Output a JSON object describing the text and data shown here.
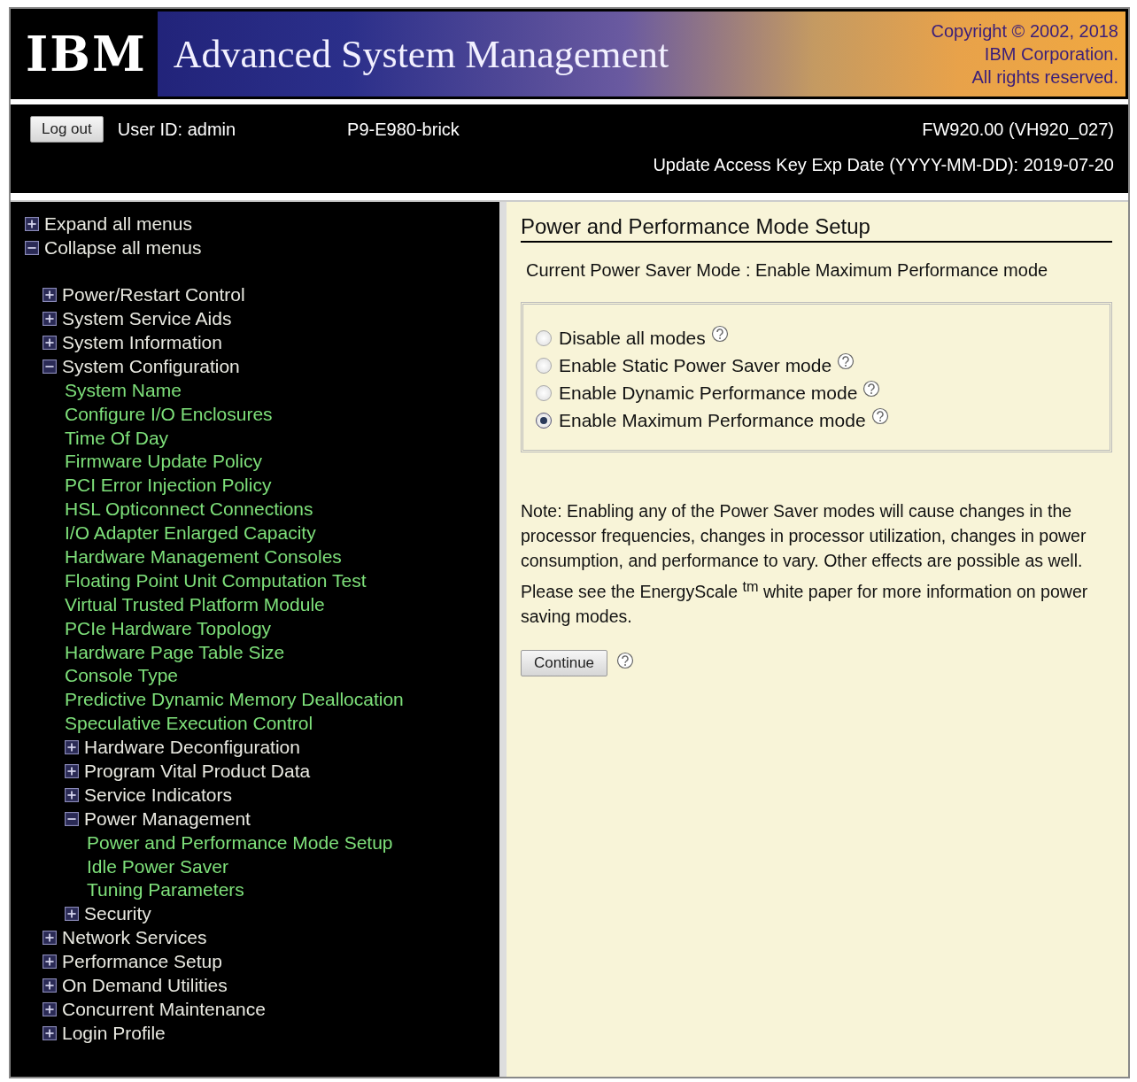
{
  "banner": {
    "logo": "IBM",
    "title": "Advanced System Management",
    "copyright": [
      "Copyright © 2002, 2018",
      "IBM Corporation.",
      "All rights reserved."
    ]
  },
  "session": {
    "logout": "Log out",
    "user": "User ID: admin",
    "system": "P9-E980-brick",
    "firmware": "FW920.00 (VH920_027)",
    "key_date": "Update Access Key Exp Date (YYYY-MM-DD): 2019-07-20"
  },
  "sidebar": {
    "actions": [
      {
        "label": "Expand all menus",
        "kind": "expand"
      },
      {
        "label": "Collapse all menus",
        "kind": "collapse"
      }
    ],
    "tree": [
      {
        "label": "Power/Restart Control",
        "expanded": false
      },
      {
        "label": "System Service Aids",
        "expanded": false
      },
      {
        "label": "System Information",
        "expanded": false
      },
      {
        "label": "System Configuration",
        "expanded": true,
        "children": [
          {
            "label": "System Name"
          },
          {
            "label": "Configure I/O Enclosures"
          },
          {
            "label": "Time Of Day"
          },
          {
            "label": "Firmware Update Policy"
          },
          {
            "label": "PCI Error Injection Policy"
          },
          {
            "label": "HSL Opticonnect Connections"
          },
          {
            "label": "I/O Adapter Enlarged Capacity"
          },
          {
            "label": "Hardware Management Consoles"
          },
          {
            "label": "Floating Point Unit Computation Test"
          },
          {
            "label": "Virtual Trusted Platform Module"
          },
          {
            "label": "PCIe Hardware Topology"
          },
          {
            "label": "Hardware Page Table Size"
          },
          {
            "label": "Console Type"
          },
          {
            "label": "Predictive Dynamic Memory Deallocation"
          },
          {
            "label": "Speculative Execution Control"
          },
          {
            "label": "Hardware Deconfiguration",
            "expanded": false
          },
          {
            "label": "Program Vital Product Data",
            "expanded": false
          },
          {
            "label": "Service Indicators",
            "expanded": false
          },
          {
            "label": "Power Management",
            "expanded": true,
            "children": [
              {
                "label": "Power and Performance Mode Setup"
              },
              {
                "label": "Idle Power Saver"
              },
              {
                "label": "Tuning Parameters"
              }
            ]
          },
          {
            "label": "Security",
            "expanded": false
          }
        ]
      },
      {
        "label": "Network Services",
        "expanded": false
      },
      {
        "label": "Performance Setup",
        "expanded": false
      },
      {
        "label": "On Demand Utilities",
        "expanded": false
      },
      {
        "label": "Concurrent Maintenance",
        "expanded": false
      },
      {
        "label": "Login Profile",
        "expanded": false
      }
    ]
  },
  "content": {
    "heading": "Power and Performance Mode Setup",
    "current_mode": "Current Power Saver Mode : Enable Maximum Performance mode",
    "modes": [
      {
        "label": "Disable all modes",
        "selected": false
      },
      {
        "label": "Enable Static Power Saver mode",
        "selected": false
      },
      {
        "label": "Enable Dynamic Performance mode",
        "selected": false
      },
      {
        "label": "Enable Maximum Performance mode",
        "selected": true
      }
    ],
    "note": "Note: Enabling any of the Power Saver modes will cause changes in the processor frequencies, changes in processor utilization, changes in power consumption, and performance to vary. Other effects are possible as well. Please see the EnergyScale $^{tm}$ white paper for more information on power saving modes.",
    "continue": "Continue"
  }
}
